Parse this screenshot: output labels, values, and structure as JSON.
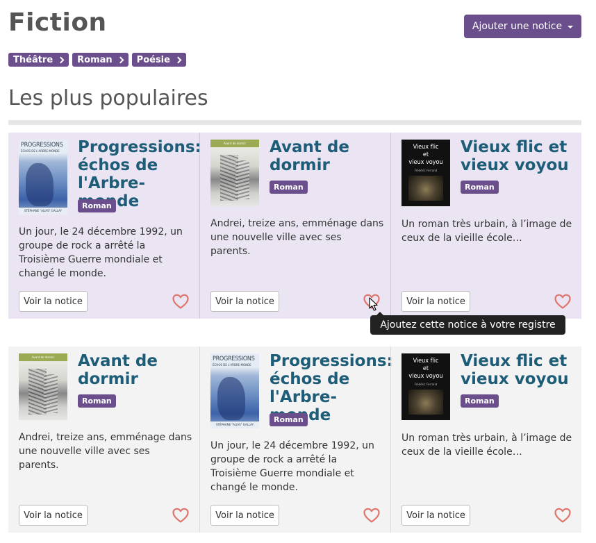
{
  "page": {
    "title": "Fiction",
    "add_button_label": "Ajouter une notice",
    "breadcrumbs": [
      "Théâtre",
      "Roman",
      "Poésie"
    ],
    "section_title": "Les plus populaires"
  },
  "cards": [
    {
      "cover": "progressions",
      "title": "Progressions:\néchos de\nl'Arbre-monde",
      "tag": "Roman",
      "description": "Un jour, le 24 décembre 1992, un groupe de rock a arrêté la Troisième Guerre mondiale et changé le monde.",
      "button": "Voir la notice"
    },
    {
      "cover": "avant",
      "title": "Avant de\ndormir",
      "tag": "Roman",
      "description": "Andrei, treize ans, emménage dans une nouvelle ville avec ses parents.",
      "button": "Voir la notice"
    },
    {
      "cover": "vieux",
      "title": "Vieux flic et\nvieux voyou",
      "tag": "Roman",
      "description": "Un roman très urbain, à l’image de ceux de la vieille école…",
      "button": "Voir la notice"
    },
    {
      "cover": "avant",
      "title": "Avant de\ndormir",
      "tag": "Roman",
      "description": "Andrei, treize ans, emménage dans une nouvelle ville avec ses parents.",
      "button": "Voir la notice"
    },
    {
      "cover": "progressions",
      "title": "Progressions:\néchos de\nl'Arbre-monde",
      "tag": "Roman",
      "description": "Un jour, le 24 décembre 1992, un groupe de rock a arrêté la Troisième Guerre mondiale et changé le monde.",
      "button": "Voir la notice"
    },
    {
      "cover": "vieux",
      "title": "Vieux flic et\nvieux voyou",
      "tag": "Roman",
      "description": "Un roman très urbain, à l’image de ceux de la vieille école…",
      "button": "Voir la notice"
    }
  ],
  "covers": {
    "progressions": {
      "title": "PROGRESSIONS",
      "subtitle": "ÉCHOS DE L'ARBRE-MONDE",
      "author": "STÉPHANE \"ALIAS\" GALLAY"
    },
    "avant": {
      "title": "Avant de dormir"
    },
    "vieux": {
      "title": "Vieux flic\net\nvieux voyou",
      "author": "Frédéric Ferrand"
    }
  },
  "tooltip": "Ajoutez cette notice à votre registre",
  "colors": {
    "accent": "#6a4f8c",
    "title_link": "#1e5d78",
    "heart": "#e0736a",
    "row1_bg": "#ebe4f3",
    "row2_bg": "#f3f3f3"
  },
  "icons": {
    "heart": "heart-outline-icon",
    "chevron": "chevron-right-icon",
    "caret": "caret-down-icon",
    "cursor": "mouse-pointer-icon"
  }
}
